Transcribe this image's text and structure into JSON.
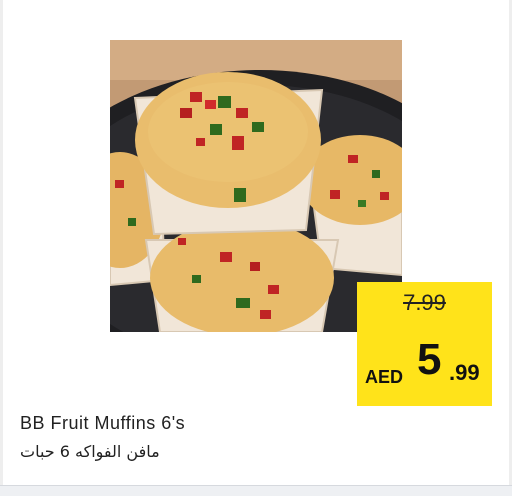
{
  "product": {
    "name_en": "BB Fruit Muffins 6's",
    "name_ar": "مافن الفواكه 6 حبات",
    "image_alt": "fruit-muffins-photo"
  },
  "price": {
    "old": "7.99",
    "currency": "AED",
    "new_main": "5",
    "new_decimal": ".99"
  },
  "colors": {
    "tag_background": "#ffe31a",
    "muffin_crust": "#e7b866",
    "liner": "#f1e6d8",
    "plate": "#1f1f22",
    "table": "#c29a74"
  }
}
